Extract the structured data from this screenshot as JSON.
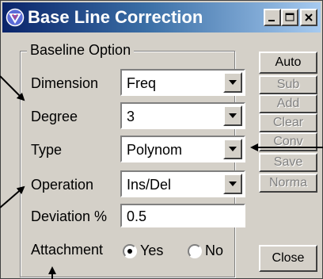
{
  "window": {
    "title": "Base Line Correction",
    "title_gradient_start": "#0a246a",
    "title_gradient_end": "#a6caf0",
    "icons": [
      "app-icon",
      "minimize-icon",
      "maximize-icon",
      "close-icon"
    ]
  },
  "group": {
    "label": "Baseline Option"
  },
  "fields": {
    "dimension": {
      "label": "Dimension",
      "value": "Freq"
    },
    "degree": {
      "label": "Degree",
      "value": "3"
    },
    "type": {
      "label": "Type",
      "value": "Polynom"
    },
    "operation": {
      "label": "Operation",
      "value": "Ins/Del"
    },
    "deviation": {
      "label": "Deviation %",
      "value": "0.5"
    },
    "attachment": {
      "label": "Attachment",
      "options": [
        {
          "label": "Yes",
          "selected": true
        },
        {
          "label": "No",
          "selected": false
        }
      ]
    }
  },
  "buttons": {
    "auto": {
      "label": "Auto",
      "enabled": true
    },
    "sub": {
      "label": "Sub",
      "enabled": false
    },
    "add": {
      "label": "Add",
      "enabled": false
    },
    "clear": {
      "label": "Clear",
      "enabled": false
    },
    "conv": {
      "label": "Conv",
      "enabled": false
    },
    "save": {
      "label": "Save",
      "enabled": false
    },
    "norma": {
      "label": "Norma",
      "enabled": false
    },
    "close": {
      "label": "Close",
      "enabled": true
    }
  },
  "colors": {
    "face": "#d4d0c8",
    "disabled_text": "#808080"
  }
}
